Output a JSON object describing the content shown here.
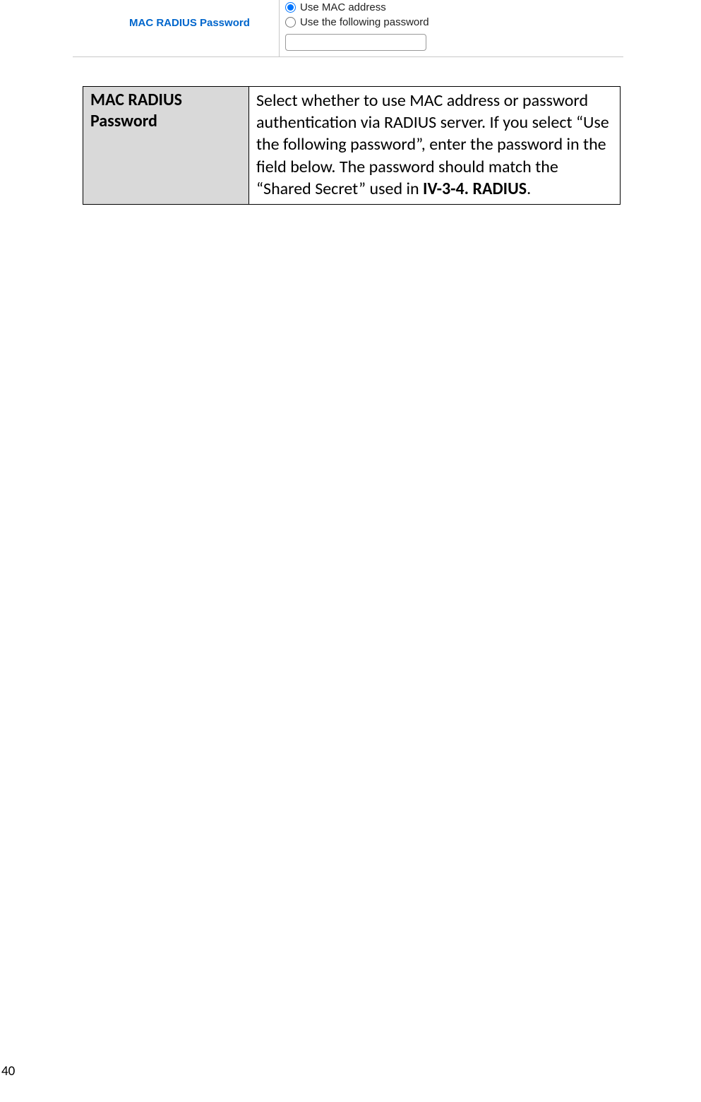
{
  "config": {
    "label": "MAC RADIUS Password",
    "option1_label": "Use MAC address",
    "option2_label": "Use the following password",
    "password_value": ""
  },
  "description_table": {
    "label": "MAC RADIUS Password",
    "text_part1": "Select whether to use MAC address or password authentication via RADIUS server. If you select “Use the following password”, enter the password in the field below. The password should match the “Shared Secret” used in ",
    "text_bold": "IV-3-4. RADIUS",
    "text_part2": "."
  },
  "page_number": "40"
}
